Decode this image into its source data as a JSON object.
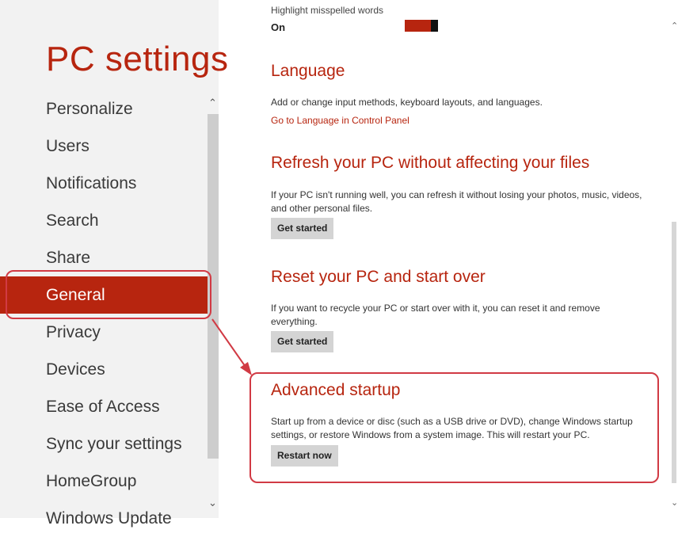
{
  "app_title": "PC settings",
  "nav": {
    "items": [
      {
        "label": "Personalize"
      },
      {
        "label": "Users"
      },
      {
        "label": "Notifications"
      },
      {
        "label": "Search"
      },
      {
        "label": "Share"
      },
      {
        "label": "General",
        "selected": true
      },
      {
        "label": "Privacy"
      },
      {
        "label": "Devices"
      },
      {
        "label": "Ease of Access"
      },
      {
        "label": "Sync your settings"
      },
      {
        "label": "HomeGroup"
      },
      {
        "label": "Windows Update"
      }
    ]
  },
  "spelling": {
    "label": "Highlight misspelled words",
    "value": "On"
  },
  "language": {
    "title": "Language",
    "desc": "Add or change input methods, keyboard layouts, and languages.",
    "link": "Go to Language in Control Panel"
  },
  "refresh": {
    "title": "Refresh your PC without affecting your files",
    "desc": "If your PC isn't running well, you can refresh it without losing your photos, music, videos, and other personal files.",
    "button": "Get started"
  },
  "reset": {
    "title": "Reset your PC and start over",
    "desc": "If you want to recycle your PC or start over with it, you can reset it and remove everything.",
    "button": "Get started"
  },
  "advanced": {
    "title": "Advanced startup",
    "desc": "Start up from a device or disc (such as a USB drive or DVD), change Windows startup settings, or restore Windows from a system image. This will restart your PC.",
    "button": "Restart now"
  },
  "colors": {
    "accent": "#b7250f",
    "annotation": "#d13a44"
  }
}
